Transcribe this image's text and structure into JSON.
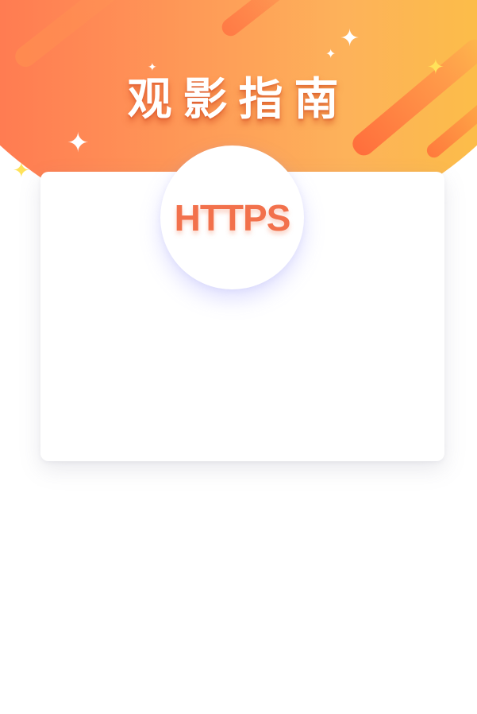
{
  "header": {
    "title": "观影指南"
  },
  "badge": {
    "label": "HTTPS"
  },
  "decorations": {
    "sparkle_glyph": "✦",
    "icons": [
      "sparkle-icon",
      "light-streak"
    ]
  },
  "colors": {
    "banner_left": "#ff6a4d",
    "banner_right": "#fbc63a",
    "badge_text": "#f2714c",
    "card_background": "#ffffff",
    "page_background": "#ffffff"
  }
}
